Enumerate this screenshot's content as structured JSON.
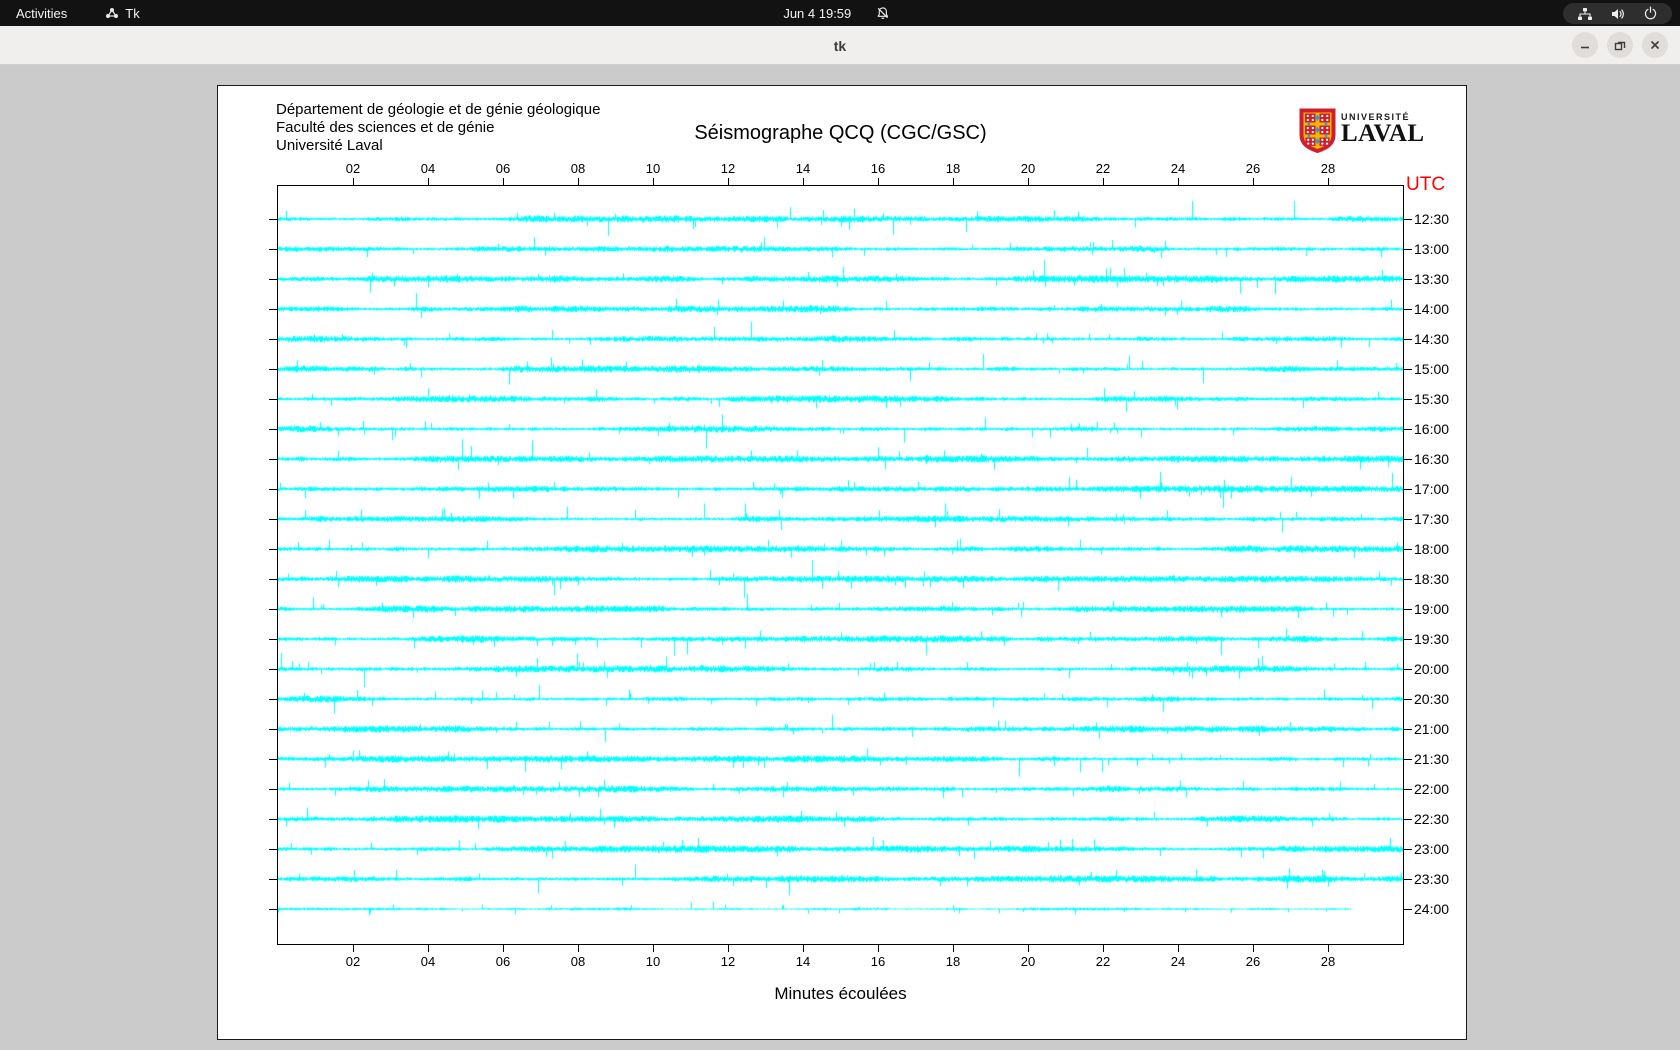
{
  "top_bar": {
    "activities_label": "Activities",
    "app_indicator_label": "Tk",
    "clock": "Jun 4  19:59"
  },
  "title_bar": {
    "title": "tk"
  },
  "app_window": {
    "header_lines": [
      "Département de géologie et de génie géologique",
      "Faculté des sciences et de génie",
      "Université Laval"
    ],
    "logo": {
      "line1": "UNIVERSITÉ",
      "line2": "LAVAL"
    }
  },
  "chart_data": {
    "type": "line",
    "title": "Séismographe QCQ (CGC/GSC)",
    "xlabel": "Minutes écoulées",
    "right_axis_title": "UTC",
    "x_ticks": [
      "02",
      "04",
      "06",
      "08",
      "10",
      "12",
      "14",
      "16",
      "18",
      "20",
      "22",
      "24",
      "26",
      "28"
    ],
    "x_range_minutes": [
      0,
      30
    ],
    "trace_color": "#00ffff",
    "utc_title_color": "#ff0000",
    "render_seed": 20250604,
    "traces": [
      {
        "utc": "12:30"
      },
      {
        "utc": "13:00"
      },
      {
        "utc": "13:30"
      },
      {
        "utc": "14:00"
      },
      {
        "utc": "14:30"
      },
      {
        "utc": "15:00"
      },
      {
        "utc": "15:30"
      },
      {
        "utc": "16:00"
      },
      {
        "utc": "16:30"
      },
      {
        "utc": "17:00"
      },
      {
        "utc": "17:30"
      },
      {
        "utc": "18:00"
      },
      {
        "utc": "18:30"
      },
      {
        "utc": "19:00"
      },
      {
        "utc": "19:30"
      },
      {
        "utc": "20:00"
      },
      {
        "utc": "20:30"
      },
      {
        "utc": "21:00"
      },
      {
        "utc": "21:30"
      },
      {
        "utc": "22:00"
      },
      {
        "utc": "22:30"
      },
      {
        "utc": "23:00"
      },
      {
        "utc": "23:30"
      },
      {
        "utc": "24:00",
        "end_minute": 28.6,
        "amp_scale": 0.5
      }
    ]
  }
}
